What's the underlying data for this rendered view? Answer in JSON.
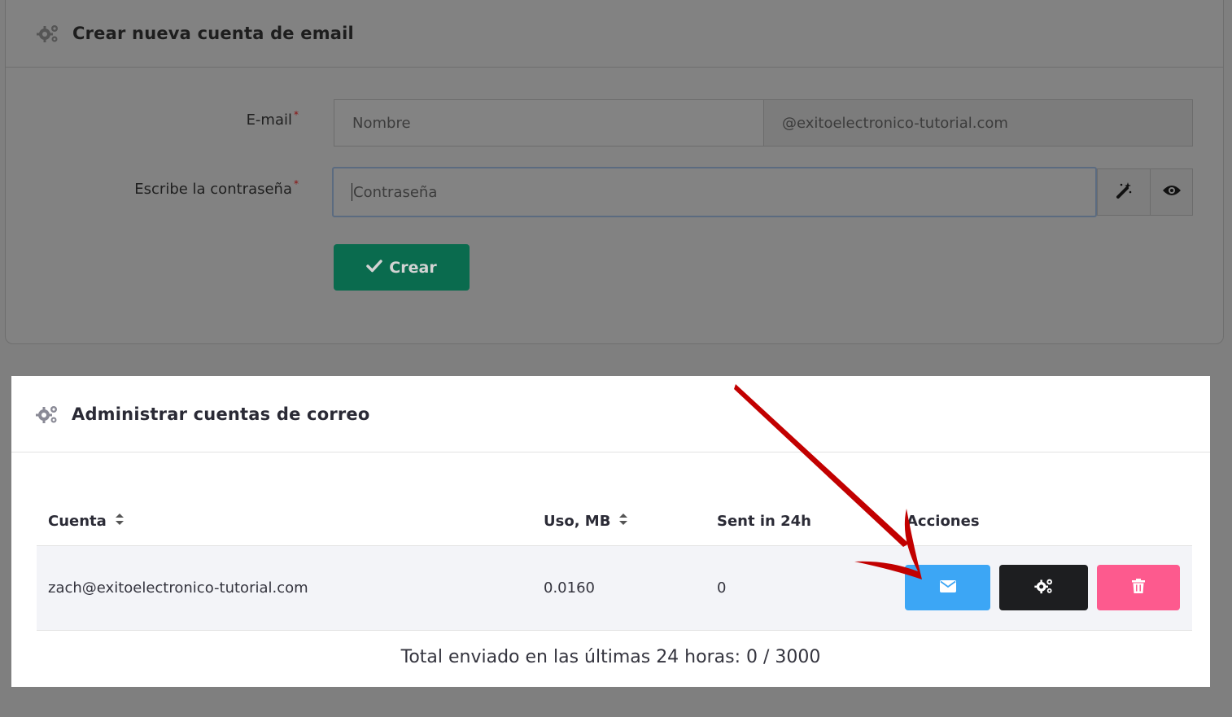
{
  "create_card": {
    "title": "Crear nueva cuenta de email",
    "icon": "gears-icon",
    "email_label": "E-mail",
    "required_mark": "*",
    "email_placeholder": "Nombre",
    "email_domain": "@exitoelectronico-tutorial.com",
    "password_label": "Escribe la contraseña",
    "password_placeholder": "Contraseña",
    "generate_icon": "magic-wand-icon",
    "show_icon": "eye-icon",
    "create_button": "Crear"
  },
  "manage_card": {
    "title": "Administrar cuentas de correo",
    "icon": "gears-icon",
    "columns": [
      "Cuenta",
      "Uso, MB",
      "Sent in 24h",
      "Acciones"
    ],
    "rows": [
      {
        "account": "zach@exitoelectronico-tutorial.com",
        "usage": "0.0160",
        "sent": "0"
      }
    ],
    "actions": [
      {
        "icon": "envelope-icon",
        "color": "#3ca6f5"
      },
      {
        "icon": "gears-icon",
        "color": "#1d1e20"
      },
      {
        "icon": "trash-icon",
        "color": "#fd5a8e"
      }
    ],
    "total": "Total enviado en las últimas 24 horas: 0 / 3000"
  },
  "colors": {
    "overlay": "#7f7f7f",
    "create_button": "#0a6b4e",
    "arrow": "#c00000"
  }
}
